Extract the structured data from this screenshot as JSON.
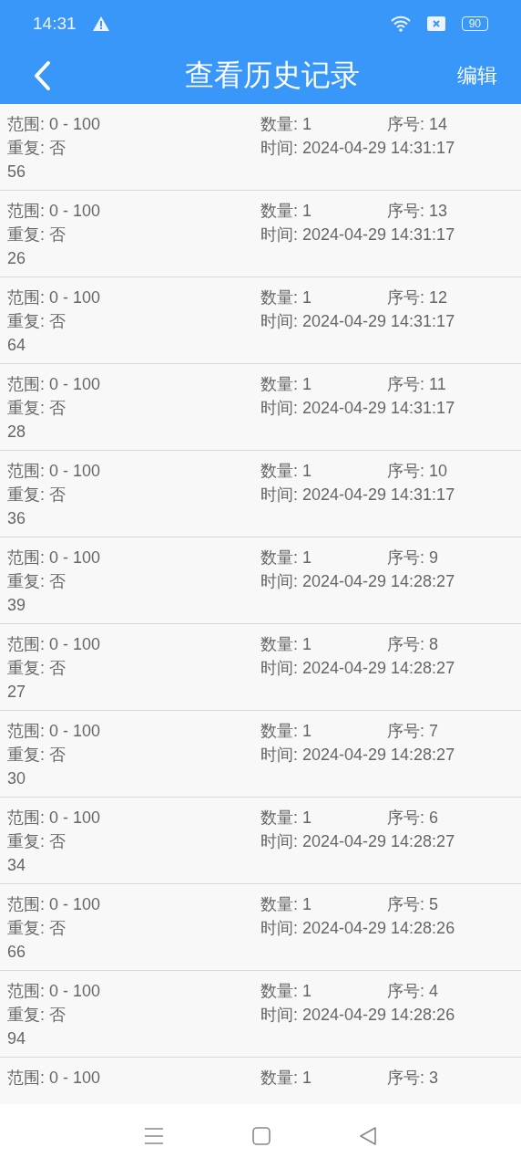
{
  "status_bar": {
    "time": "14:31",
    "battery": "90"
  },
  "header": {
    "title": "查看历史记录",
    "action": "编辑"
  },
  "records": [
    {
      "range": "范围: 0 - 100",
      "count": "数量: 1",
      "serial": "序号: 14",
      "repeat": "重复: 否",
      "time": "时间: 2024-04-29 14:31:17",
      "value": "56"
    },
    {
      "range": "范围: 0 - 100",
      "count": "数量: 1",
      "serial": "序号: 13",
      "repeat": "重复: 否",
      "time": "时间: 2024-04-29 14:31:17",
      "value": "26"
    },
    {
      "range": "范围: 0 - 100",
      "count": "数量: 1",
      "serial": "序号: 12",
      "repeat": "重复: 否",
      "time": "时间: 2024-04-29 14:31:17",
      "value": "64"
    },
    {
      "range": "范围: 0 - 100",
      "count": "数量: 1",
      "serial": "序号: 11",
      "repeat": "重复: 否",
      "time": "时间: 2024-04-29 14:31:17",
      "value": "28"
    },
    {
      "range": "范围: 0 - 100",
      "count": "数量: 1",
      "serial": "序号: 10",
      "repeat": "重复: 否",
      "time": "时间: 2024-04-29 14:31:17",
      "value": "36"
    },
    {
      "range": "范围: 0 - 100",
      "count": "数量: 1",
      "serial": "序号: 9",
      "repeat": "重复: 否",
      "time": "时间: 2024-04-29 14:28:27",
      "value": "39"
    },
    {
      "range": "范围: 0 - 100",
      "count": "数量: 1",
      "serial": "序号: 8",
      "repeat": "重复: 否",
      "time": "时间: 2024-04-29 14:28:27",
      "value": "27"
    },
    {
      "range": "范围: 0 - 100",
      "count": "数量: 1",
      "serial": "序号: 7",
      "repeat": "重复: 否",
      "time": "时间: 2024-04-29 14:28:27",
      "value": "30"
    },
    {
      "range": "范围: 0 - 100",
      "count": "数量: 1",
      "serial": "序号: 6",
      "repeat": "重复: 否",
      "time": "时间: 2024-04-29 14:28:27",
      "value": "34"
    },
    {
      "range": "范围: 0 - 100",
      "count": "数量: 1",
      "serial": "序号: 5",
      "repeat": "重复: 否",
      "time": "时间: 2024-04-29 14:28:26",
      "value": "66"
    },
    {
      "range": "范围: 0 - 100",
      "count": "数量: 1",
      "serial": "序号: 4",
      "repeat": "重复: 否",
      "time": "时间: 2024-04-29 14:28:26",
      "value": "94"
    },
    {
      "range": "范围: 0 - 100",
      "count": "数量: 1",
      "serial": "序号: 3"
    }
  ]
}
